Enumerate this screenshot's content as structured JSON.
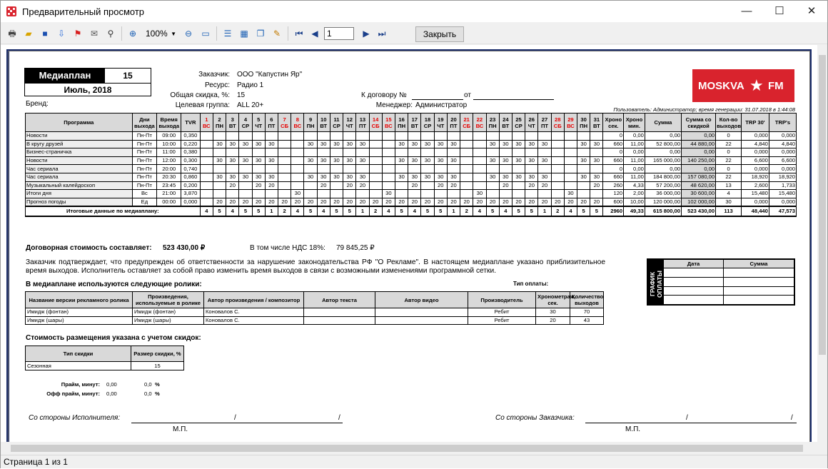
{
  "window": {
    "title": "Предварительный просмотр",
    "minimize": "—",
    "maximize": "☐",
    "close": "✕"
  },
  "toolbar": {
    "zoom": "100%",
    "page": "1",
    "close_label": "Закрыть"
  },
  "status": "Страница 1 из 1",
  "report": {
    "mediaplan_label": "Медиаплан",
    "mediaplan_no": "15",
    "period": "Июль, 2018",
    "brand_label": "Бренд:",
    "customer_label": "Заказчик:",
    "customer": "ООО \"Капустин Яр\"",
    "resource_label": "Ресурс:",
    "resource": "Радио 1",
    "discount_label": "Общая скидка, %:",
    "discount": "15",
    "target_label": "Целевая группа:",
    "target": "ALL 20+",
    "contract_label": "К договору №",
    "from_label": "от",
    "manager_label": "Менеджер:",
    "manager": "Администратор",
    "user_info": "Пользователь: Администратор; время генерации: 31.07.2018 в 1:44:08",
    "logo_left": "MOSKVA",
    "logo_star": "★",
    "logo_right": "FM",
    "headers": {
      "program": "Программа",
      "days": "Дни выхода",
      "time": "Время выхода",
      "tvr": "TVR",
      "chrono_sec": "Хроно сек.",
      "chrono_min": "Хроно мин.",
      "sum": "Сумма",
      "sum_disc": "Сумма со скидкой",
      "count": "Кол-во выходов",
      "trp30": "TRP 30'",
      "trps": "TRP's"
    },
    "dates": [
      {
        "d": "1",
        "w": "ВС",
        "we": true
      },
      {
        "d": "2",
        "w": "ПН"
      },
      {
        "d": "3",
        "w": "ВТ"
      },
      {
        "d": "4",
        "w": "СР"
      },
      {
        "d": "5",
        "w": "ЧТ"
      },
      {
        "d": "6",
        "w": "ПТ"
      },
      {
        "d": "7",
        "w": "СБ",
        "we": true
      },
      {
        "d": "8",
        "w": "ВС",
        "we": true
      },
      {
        "d": "9",
        "w": "ПН"
      },
      {
        "d": "10",
        "w": "ВТ"
      },
      {
        "d": "11",
        "w": "СР"
      },
      {
        "d": "12",
        "w": "ЧТ"
      },
      {
        "d": "13",
        "w": "ПТ"
      },
      {
        "d": "14",
        "w": "СБ",
        "we": true
      },
      {
        "d": "15",
        "w": "ВС",
        "we": true
      },
      {
        "d": "16",
        "w": "ПН"
      },
      {
        "d": "17",
        "w": "ВТ"
      },
      {
        "d": "18",
        "w": "СР"
      },
      {
        "d": "19",
        "w": "ЧТ"
      },
      {
        "d": "20",
        "w": "ПТ"
      },
      {
        "d": "21",
        "w": "СБ",
        "we": true
      },
      {
        "d": "22",
        "w": "ВС",
        "we": true
      },
      {
        "d": "23",
        "w": "ПН"
      },
      {
        "d": "24",
        "w": "ВТ"
      },
      {
        "d": "25",
        "w": "СР"
      },
      {
        "d": "26",
        "w": "ЧТ"
      },
      {
        "d": "27",
        "w": "ПТ"
      },
      {
        "d": "28",
        "w": "СБ",
        "we": true
      },
      {
        "d": "29",
        "w": "ВС",
        "we": true
      },
      {
        "d": "30",
        "w": "ПН"
      },
      {
        "d": "31",
        "w": "ВТ"
      }
    ],
    "rows": [
      {
        "name": "Новости",
        "days": "Пн-Пт",
        "time": "09:00",
        "tvr": "0,350",
        "cells": [],
        "cs": "0",
        "cm": "0,00",
        "sum": "0,00",
        "sd": "0,00",
        "cnt": "0",
        "trp30": "0,000",
        "trps": "0,000"
      },
      {
        "name": "В кругу друзей",
        "days": "Пн-Пт",
        "time": "10:00",
        "tvr": "0,220",
        "cells": [
          "",
          "30",
          "30",
          "30",
          "30",
          "30",
          "",
          "",
          "30",
          "30",
          "30",
          "30",
          "30",
          "",
          "",
          "30",
          "30",
          "30",
          "30",
          "30",
          "",
          "",
          "30",
          "30",
          "30",
          "30",
          "30",
          "",
          "",
          "30",
          "30"
        ],
        "cs": "660",
        "cm": "11,00",
        "sum": "52 800,00",
        "sd": "44 880,00",
        "cnt": "22",
        "trp30": "4,840",
        "trps": "4,840"
      },
      {
        "name": "Бизнес-страничка",
        "days": "Пн-Пт",
        "time": "11:00",
        "tvr": "0,380",
        "cells": [],
        "cs": "0",
        "cm": "0,00",
        "sum": "0,00",
        "sd": "0,00",
        "cnt": "0",
        "trp30": "0,000",
        "trps": "0,000"
      },
      {
        "name": "Новости",
        "days": "Пн-Пт",
        "time": "12:00",
        "tvr": "0,300",
        "cells": [
          "",
          "30",
          "30",
          "30",
          "30",
          "30",
          "",
          "",
          "30",
          "30",
          "30",
          "30",
          "30",
          "",
          "",
          "30",
          "30",
          "30",
          "30",
          "30",
          "",
          "",
          "30",
          "30",
          "30",
          "30",
          "30",
          "",
          "",
          "30",
          "30"
        ],
        "cs": "660",
        "cm": "11,00",
        "sum": "165 000,00",
        "sd": "140 250,00",
        "cnt": "22",
        "trp30": "6,600",
        "trps": "6,600"
      },
      {
        "name": "Час сериала",
        "days": "Пн-Пт",
        "time": "20:00",
        "tvr": "0,740",
        "cells": [],
        "cs": "0",
        "cm": "0,00",
        "sum": "0,00",
        "sd": "0,00",
        "cnt": "0",
        "trp30": "0,000",
        "trps": "0,000"
      },
      {
        "name": "Час сериала",
        "days": "Пн-Пт",
        "time": "20:30",
        "tvr": "0,860",
        "cells": [
          "",
          "30",
          "30",
          "30",
          "30",
          "30",
          "",
          "",
          "30",
          "30",
          "30",
          "30",
          "30",
          "",
          "",
          "30",
          "30",
          "30",
          "30",
          "30",
          "",
          "",
          "30",
          "30",
          "30",
          "30",
          "30",
          "",
          "",
          "30",
          "30"
        ],
        "cs": "660",
        "cm": "11,00",
        "sum": "184 800,00",
        "sd": "157 080,00",
        "cnt": "22",
        "trp30": "18,920",
        "trps": "18,920"
      },
      {
        "name": "Музыкальный калейдоскоп",
        "days": "Пн-Пт",
        "time": "23:45",
        "tvr": "0,200",
        "cells": [
          "",
          "",
          "20",
          "",
          "20",
          "20",
          "",
          "",
          "",
          "20",
          "",
          "20",
          "20",
          "",
          "",
          "",
          "20",
          "",
          "20",
          "20",
          "",
          "",
          "",
          "20",
          "",
          "20",
          "20",
          "",
          "",
          "",
          "20"
        ],
        "cs": "260",
        "cm": "4,33",
        "sum": "57 200,00",
        "sd": "48 620,00",
        "cnt": "13",
        "trp30": "2,600",
        "trps": "1,733"
      },
      {
        "name": "Итоги дня",
        "days": "Вс",
        "time": "21:00",
        "tvr": "3,870",
        "cells": [
          "",
          "",
          "",
          "",
          "",
          "",
          "",
          "30",
          "",
          "",
          "",
          "",
          "",
          "",
          "30",
          "",
          "",
          "",
          "",
          "",
          "",
          "30",
          "",
          "",
          "",
          "",
          "",
          "",
          "30",
          "",
          ""
        ],
        "cs": "120",
        "cm": "2,00",
        "sum": "36 000,00",
        "sd": "30 600,00",
        "cnt": "4",
        "trp30": "15,480",
        "trps": "15,480"
      },
      {
        "name": "Прогноз погоды",
        "days": "Ед",
        "time": "00:00",
        "tvr": "0,000",
        "cells": [
          "",
          "20",
          "20",
          "20",
          "20",
          "20",
          "20",
          "20",
          "20",
          "20",
          "20",
          "20",
          "20",
          "20",
          "20",
          "20",
          "20",
          "20",
          "20",
          "20",
          "20",
          "20",
          "20",
          "20",
          "20",
          "20",
          "20",
          "20",
          "20",
          "20",
          "20"
        ],
        "cs": "600",
        "cm": "10,00",
        "sum": "120 000,00",
        "sd": "102 000,00",
        "cnt": "30",
        "trp30": "0,000",
        "trps": "0,000"
      }
    ],
    "total": {
      "label": "Итоговые данные по медиаплану:",
      "cells": [
        "4",
        "5",
        "4",
        "5",
        "5",
        "1",
        "2",
        "4",
        "5",
        "4",
        "5",
        "5",
        "1",
        "2",
        "4",
        "5",
        "4",
        "5",
        "5",
        "1",
        "2",
        "4",
        "5",
        "4",
        "5",
        "5",
        "1",
        "2",
        "4",
        "5",
        "5"
      ],
      "cs": "2960",
      "cm": "49,33",
      "sum": "615 800,00",
      "sd": "523 430,00",
      "cnt": "113",
      "trp30": "48,440",
      "trps": "47,573"
    },
    "contract_cost_label": "Договорная стоимость составляет:",
    "contract_cost": "523 430,00 ₽",
    "vat_label": "В том числе НДС 18%:",
    "vat": "79 845,25 ₽",
    "disclaimer": "Заказчик подтверждает, что предупрежден об ответственности за нарушение законодательства РФ \"О Рекламе\". В настоящем медиаплане указано приблизительное время выходов. Исполнитель оставляет за собой право изменить время выходов в связи с возможными изменениями программной сетки.",
    "rolls_title": "В медиаплане используются следующие ролики:",
    "pay_type_label": "Тип оплаты:",
    "roll_headers": [
      "Название версии рекламного ролика",
      "Произведения, используемые в ролике",
      "Автор произведения / композитор",
      "Автор текста",
      "Автор видео",
      "Производитель",
      "Хронометраж, сек.",
      "Количество выходов"
    ],
    "rolls": [
      [
        "Имидж (фонтан)",
        "Имидж (фонтан)",
        "Коновалов С.",
        "",
        "",
        "Ребит",
        "30",
        "70"
      ],
      [
        "Имидж (шары)",
        "Имидж (шары)",
        "Коновалов С.",
        "",
        "",
        "Ребит",
        "20",
        "43"
      ]
    ],
    "schedule_title": "ГРАФИК ОПЛАТЫ",
    "schedule_headers": [
      "Дата",
      "Сумма"
    ],
    "discount_title": "Стоимость размещения указана с учетом скидок:",
    "discount_headers": [
      "Тип скидки",
      "Размер скидки, %"
    ],
    "discount_rows": [
      [
        "Сезонная",
        "15"
      ]
    ],
    "prime_label": "Прайм, минут:",
    "prime_min": "0,00",
    "prime_pct": "0,0",
    "offprime_label": "Офф прайм, минут:",
    "offprime_min": "0,00",
    "offprime_pct": "0,0",
    "pct_sign": "%",
    "exec_side": "Со стороны Исполнителя:",
    "cust_side": "Со стороны Заказчика:",
    "slash": "/",
    "mp": "М.П."
  }
}
